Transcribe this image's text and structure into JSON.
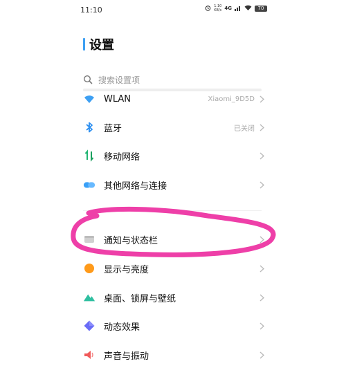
{
  "status_bar": {
    "time": "11:10",
    "net_speed": "1.10\nKB/s",
    "network": "4G",
    "battery": "70"
  },
  "page": {
    "title": "设置"
  },
  "search": {
    "placeholder": "搜索设置项"
  },
  "rows": [
    {
      "label": "WLAN",
      "value": "Xiaomi_9D5D",
      "icon": "wifi-icon",
      "color": "#3ea0f3"
    },
    {
      "label": "蓝牙",
      "value": "已关闭",
      "icon": "bluetooth-icon",
      "color": "#2b8ef0"
    },
    {
      "label": "移动网络",
      "value": "",
      "icon": "mobile-data-icon",
      "color": "#22b573"
    },
    {
      "label": "其他网络与连接",
      "value": "",
      "icon": "link-icon",
      "color": "#3aa0f7"
    },
    {
      "label": "通知与状态栏",
      "value": "",
      "icon": "notification-icon",
      "color": "#cccccc"
    },
    {
      "label": "显示与亮度",
      "value": "",
      "icon": "brightness-icon",
      "color": "#ff9a1a"
    },
    {
      "label": "桌面、锁屏与壁纸",
      "value": "",
      "icon": "wallpaper-icon",
      "color": "#2ebfa0"
    },
    {
      "label": "动态效果",
      "value": "",
      "icon": "dynamic-effect-icon",
      "color": "#6a6cf7"
    },
    {
      "label": "声音与振动",
      "value": "",
      "icon": "sound-icon",
      "color": "#f05a5a"
    }
  ],
  "annotation": {
    "color": "#ee3fa8"
  }
}
